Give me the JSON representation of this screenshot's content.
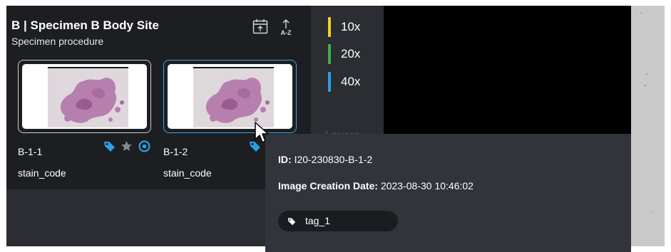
{
  "specimen": {
    "title": "B | Specimen B Body Site",
    "subtitle": "Specimen procedure",
    "sort_label": "A-Z"
  },
  "images": [
    {
      "label": "B-1-1",
      "stain": "stain_code",
      "selected": false
    },
    {
      "label": "B-1-2",
      "stain": "stain_code",
      "selected": true
    }
  ],
  "magnifications": [
    {
      "label": "10x",
      "color": "#f2d21b"
    },
    {
      "label": "20x",
      "color": "#3fae49"
    },
    {
      "label": "40x",
      "color": "#2aa0e6"
    }
  ],
  "layers_label": "Layers",
  "tooltip": {
    "id_key": "ID:",
    "id_value": "I20-230830-B-1-2",
    "date_key": "Image Creation Date:",
    "date_value": "2023-08-30 10:46:02",
    "tag": "tag_1"
  },
  "colors": {
    "accent": "#3aa6e6",
    "tag_icon": "#2aa0e6",
    "star_icon": "#8a8a8a",
    "eye_icon": "#2aa0e6"
  }
}
